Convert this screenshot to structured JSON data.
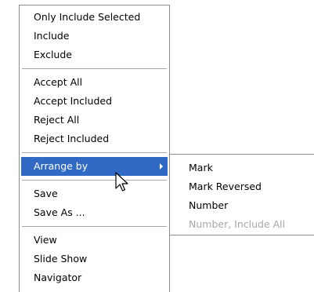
{
  "context_menu": {
    "groups": [
      [
        "Only Include Selected",
        "Include",
        "Exclude"
      ],
      [
        "Accept All",
        "Accept Included",
        "Reject All",
        "Reject Included"
      ],
      [
        "Arrange by"
      ],
      [
        "Save",
        "Save As ..."
      ],
      [
        "View",
        "Slide Show",
        "Navigator"
      ]
    ],
    "highlighted_item": "Arrange by",
    "highlight_color": "#316ac5"
  },
  "submenu": {
    "parent": "Arrange by",
    "items": [
      "Mark",
      "Mark Reversed",
      "Number",
      "Number, Include All"
    ],
    "disabled_items": [
      "Number, Include All"
    ]
  },
  "icons": {
    "submenu_arrow": "chevron-right-icon",
    "mouse_cursor": "mouse-pointer-icon"
  }
}
